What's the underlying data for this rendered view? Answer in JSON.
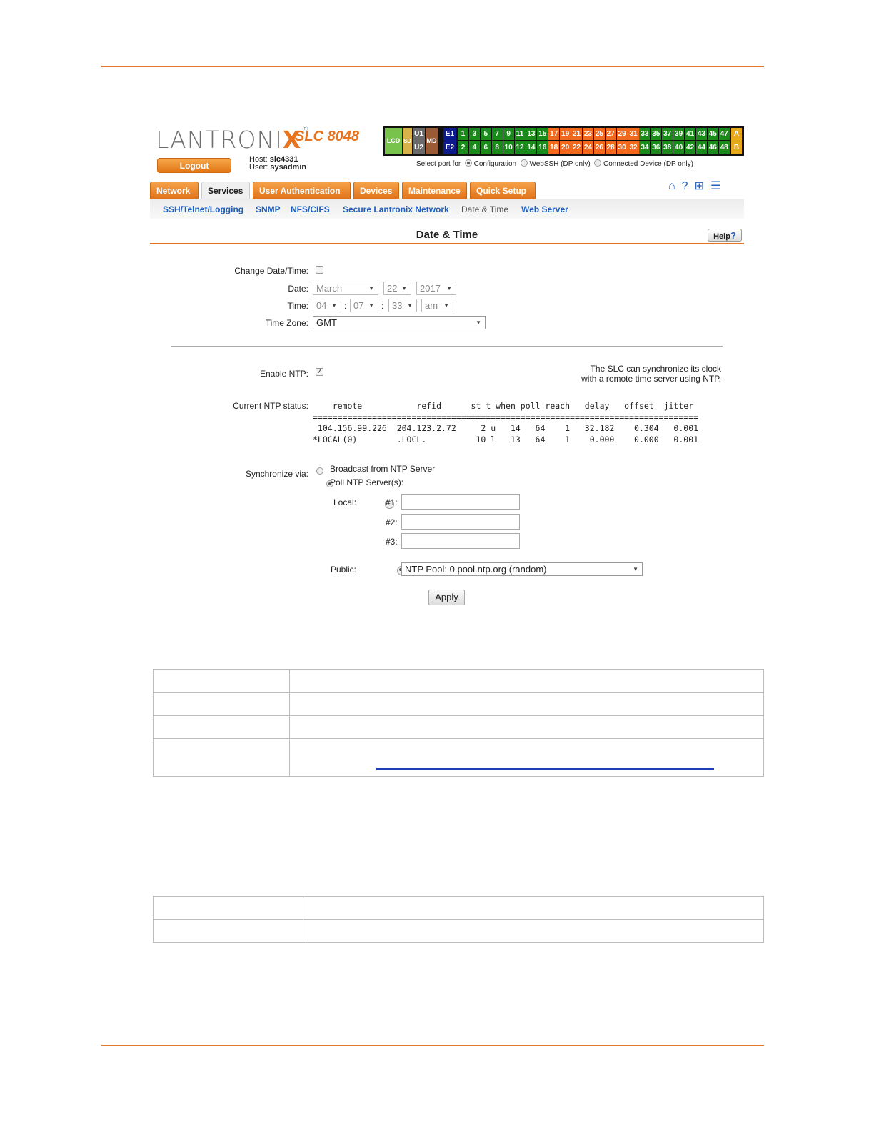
{
  "brand": {
    "logo": "LANTRONIX",
    "registered": "®",
    "model": "SLC 8048"
  },
  "header": {
    "logout_label": "Logout",
    "host_label": "Host:",
    "host_value": "slc4331",
    "user_label": "User:",
    "user_value": "sysadmin"
  },
  "port_panel": {
    "lcd": "LCD",
    "sd": "SD",
    "u1": "U1",
    "u2": "U2",
    "md": "MD",
    "e1": "E1",
    "e2": "E2",
    "odd_ports": [
      "1",
      "3",
      "5",
      "7",
      "9",
      "11",
      "13",
      "15",
      "17",
      "19",
      "21",
      "23",
      "25",
      "27",
      "29",
      "31",
      "33",
      "35",
      "37",
      "39",
      "41",
      "43",
      "45",
      "47"
    ],
    "even_ports": [
      "2",
      "4",
      "6",
      "8",
      "10",
      "12",
      "14",
      "16",
      "18",
      "20",
      "22",
      "24",
      "26",
      "28",
      "30",
      "32",
      "34",
      "36",
      "38",
      "40",
      "42",
      "44",
      "46",
      "48"
    ],
    "a": "A",
    "b": "B",
    "colors": {
      "green": "#1a8a1a",
      "orange": "#f2681c",
      "navy": "#0c1a8c",
      "lcd": "#77c34b",
      "sd": "#d8b34a",
      "md": "#9a5a36",
      "usb": "#6a6a6a",
      "ab": "#e8a81c"
    }
  },
  "select_port": {
    "label": "Select port for",
    "options": [
      "Configuration",
      "WebSSH (DP only)",
      "Connected Device (DP only)"
    ],
    "selected": "Configuration"
  },
  "tabs": [
    "Network",
    "Services",
    "User Authentication",
    "Devices",
    "Maintenance",
    "Quick Setup"
  ],
  "active_tab": "Services",
  "subnav": [
    "SSH/Telnet/Logging",
    "SNMP",
    "NFS/CIFS",
    "Secure Lantronix Network",
    "Date & Time",
    "Web Server"
  ],
  "top_icons": [
    "home-icon",
    "help-icon",
    "site-map-icon",
    "log-icon"
  ],
  "page": {
    "title": "Date & Time",
    "help_label": "Help"
  },
  "form": {
    "change_datetime_label": "Change Date/Time:",
    "date_label": "Date:",
    "date_month": "March",
    "date_day": "22",
    "date_year": "2017",
    "time_label": "Time:",
    "time_hour": "04",
    "time_minute": "07",
    "time_second": "33",
    "time_ampm": "am",
    "timezone_label": "Time Zone:",
    "timezone_value": "GMT",
    "enable_ntp_label": "Enable NTP:",
    "ntp_note_line1": "The SLC can synchronize its clock",
    "ntp_note_line2": "with a remote time server using NTP.",
    "ntp_status_label": "Current NTP status:",
    "ntp_status_text": "    remote           refid      st t when poll reach   delay   offset  jitter\n==============================================================================\n 104.156.99.226  204.123.2.72     2 u   14   64    1   32.182    0.304   0.001\n*LOCAL(0)        .LOCL.          10 l   13   64    1    0.000    0.000   0.001",
    "sync_label": "Synchronize via:",
    "sync_broadcast": "Broadcast from NTP Server",
    "sync_poll": "Poll NTP Server(s):",
    "local_label": "Local:",
    "server1_label": "#1:",
    "server2_label": "#2:",
    "server3_label": "#3:",
    "public_label": "Public:",
    "public_value": "NTP Pool: 0.pool.ntp.org (random)",
    "apply_label": "Apply"
  }
}
